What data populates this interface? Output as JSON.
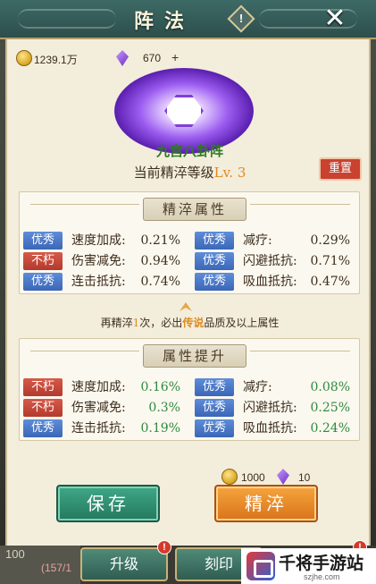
{
  "header": {
    "title": "阵法",
    "info_icon": "!",
    "close_icon": "✕"
  },
  "resources": {
    "coins": "1239.1万",
    "gems": "670",
    "add": "+"
  },
  "formation": {
    "name": "九宫八卦阵",
    "level_label": "当前精淬等级",
    "level_value": "Lv. 3",
    "reset_label": "重置"
  },
  "current_attrs": {
    "title": "精淬属性",
    "rows": [
      {
        "tag": "优秀",
        "tag_color": "blue",
        "name": "速度加成:",
        "value": "0.21%"
      },
      {
        "tag": "不朽",
        "tag_color": "red",
        "name": "伤害减免:",
        "value": "0.94%"
      },
      {
        "tag": "优秀",
        "tag_color": "blue",
        "name": "连击抵抗:",
        "value": "0.74%"
      }
    ],
    "rows_right": [
      {
        "tag": "优秀",
        "tag_color": "blue",
        "name": "减疗:",
        "value": "0.29%"
      },
      {
        "tag": "优秀",
        "tag_color": "blue",
        "name": "闪避抵抗:",
        "value": "0.71%"
      },
      {
        "tag": "优秀",
        "tag_color": "blue",
        "name": "吸血抵抗:",
        "value": "0.47%"
      }
    ]
  },
  "hint": {
    "prefix": "再精淬",
    "count": "1",
    "middle": "次，必出",
    "quality": "传说",
    "suffix": "品质及以上属性"
  },
  "upgrade_attrs": {
    "title": "属性提升",
    "rows": [
      {
        "tag": "不朽",
        "tag_color": "red",
        "name": "速度加成:",
        "value": "0.16%"
      },
      {
        "tag": "不朽",
        "tag_color": "red",
        "name": "伤害减免:",
        "value": "0.3%"
      },
      {
        "tag": "优秀",
        "tag_color": "blue",
        "name": "连击抵抗:",
        "value": "0.19%"
      }
    ],
    "rows_right": [
      {
        "tag": "优秀",
        "tag_color": "blue",
        "name": "减疗:",
        "value": "0.08%"
      },
      {
        "tag": "优秀",
        "tag_color": "blue",
        "name": "闪避抵抗:",
        "value": "0.25%"
      },
      {
        "tag": "优秀",
        "tag_color": "blue",
        "name": "吸血抵抗:",
        "value": "0.24%"
      }
    ]
  },
  "cost": {
    "coins": "1000",
    "gems": "10"
  },
  "actions": {
    "save_label": "保存",
    "refine_label": "精淬"
  },
  "bottom_nav": {
    "left_info_1": "100",
    "left_info_2": "(157/1",
    "upgrade_label": "升级",
    "engrave_label": "刻印",
    "badge": "!"
  },
  "watermark": {
    "name": "千将手游站",
    "url": "szjhe.com"
  },
  "colors": {
    "tag_blue": "#3a66b7",
    "tag_red": "#b33a2c",
    "save_btn": "#24785e",
    "refine_btn": "#d9731a",
    "accent_orange": "#e08a1e",
    "name_green": "#2f7a1f"
  }
}
